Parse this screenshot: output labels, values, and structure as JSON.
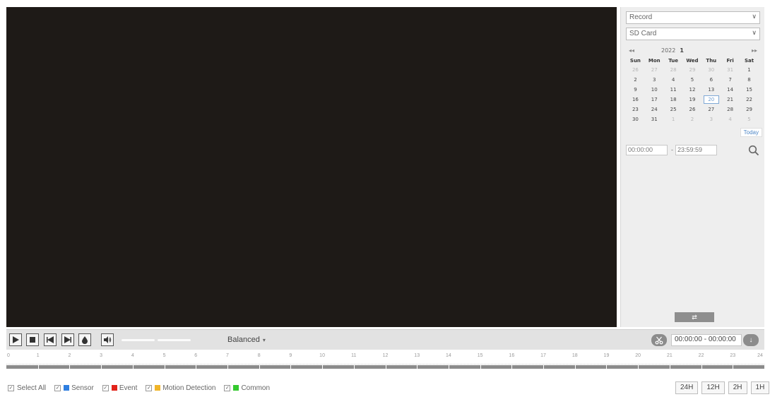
{
  "sidebar": {
    "record_select": "Record",
    "storage_select": "SD Card",
    "calendar": {
      "year": "2022",
      "month": "1",
      "nav_prev": "◂◂",
      "nav_next": "▸▸",
      "weekdays": [
        "Sun",
        "Mon",
        "Tue",
        "Wed",
        "Thu",
        "Fri",
        "Sat"
      ],
      "weeks": [
        [
          "26",
          "27",
          "28",
          "29",
          "30",
          "31",
          "1"
        ],
        [
          "2",
          "3",
          "4",
          "5",
          "6",
          "7",
          "8"
        ],
        [
          "9",
          "10",
          "11",
          "12",
          "13",
          "14",
          "15"
        ],
        [
          "16",
          "17",
          "18",
          "19",
          "20",
          "21",
          "22"
        ],
        [
          "23",
          "24",
          "25",
          "26",
          "27",
          "28",
          "29"
        ],
        [
          "30",
          "31",
          "1",
          "2",
          "3",
          "4",
          "5"
        ]
      ],
      "selected_day": "20",
      "today_label": "Today"
    },
    "start_time": "00:00:00",
    "time_dash": "-",
    "end_time": "23:59:59",
    "collapse_label": "⇄"
  },
  "controls": {
    "stream_mode": "Balanced",
    "stream_caret": "▾",
    "clip_range": "00:00:00 - 00:00:00",
    "download_symbol": "↓"
  },
  "timeline": {
    "hours": [
      "0",
      "1",
      "2",
      "3",
      "4",
      "5",
      "6",
      "7",
      "8",
      "9",
      "10",
      "11",
      "12",
      "13",
      "14",
      "15",
      "16",
      "17",
      "18",
      "19",
      "20",
      "21",
      "22",
      "23",
      "24"
    ]
  },
  "legend": {
    "select_all": "Select All",
    "sensor": "Sensor",
    "event": "Event",
    "motion": "Motion Detection",
    "common": "Common",
    "check_mark": "✓",
    "colors": {
      "sensor": "#2f7fe0",
      "event": "#e2231a",
      "motion": "#f0b429",
      "common": "#35c92f"
    }
  },
  "zoom": [
    "24H",
    "12H",
    "2H",
    "1H"
  ]
}
